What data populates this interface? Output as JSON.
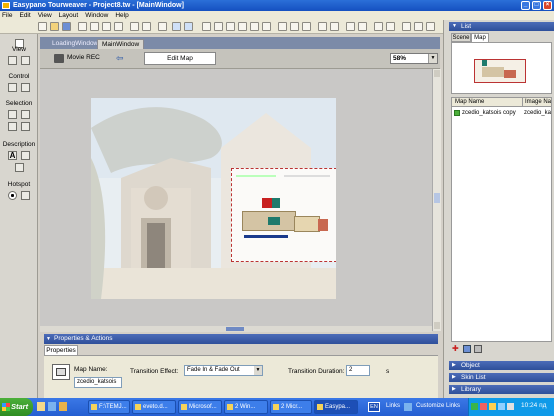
{
  "window": {
    "title": "Easypano Tourweaver - Project8.tw - [MainWindow]",
    "min": "_",
    "max": "□",
    "close": "×"
  },
  "menu": [
    "File",
    "Edit",
    "View",
    "Layout",
    "Window",
    "Help"
  ],
  "tool_palette": {
    "view": "View",
    "control": "Control",
    "selection": "Selection",
    "description": "Description",
    "description_text_icon": "A",
    "hotspot": "Hotspot"
  },
  "doc_tabs": [
    "LoadingWindow",
    "MainWindow"
  ],
  "edit_bar": {
    "movie_rec": "Movie REC",
    "edit_map": "Edit Map",
    "zoom": "58%"
  },
  "properties": {
    "header": "Properties & Actions",
    "tab": "Properties",
    "map_name_label": "Map Name:",
    "map_name_value": "zcedio_katsois",
    "transition_effect_label": "Transition Effect:",
    "transition_effect_value": "Fade In & Fade Out",
    "transition_duration_label": "Transition Duration:",
    "transition_duration_value": "2",
    "transition_duration_unit": "s"
  },
  "right_panel": {
    "list_header": "List",
    "tabs": [
      "Scene",
      "Map"
    ],
    "columns": [
      "Map Name",
      "Image Na"
    ],
    "rows": [
      {
        "name": "zcedio_katsois copy",
        "image": "zcedio_ka"
      }
    ],
    "sections": [
      "Object",
      "Skin List",
      "Library"
    ]
  },
  "taskbar": {
    "start": "Start",
    "buttons": [
      "F:\\TEMJ...",
      "eveto.d...",
      "Microsof...",
      "2 Win...",
      "2 Micr...",
      "Easypa..."
    ],
    "lang": "EN",
    "links": "Links",
    "customize_links": "Customize Links",
    "time": "10:24 пд"
  },
  "colors": {
    "title_blue": "#1550c0",
    "panel_header": "#2e4f9a",
    "taskbar_blue": "#245ed1",
    "start_green": "#2e8c22"
  }
}
